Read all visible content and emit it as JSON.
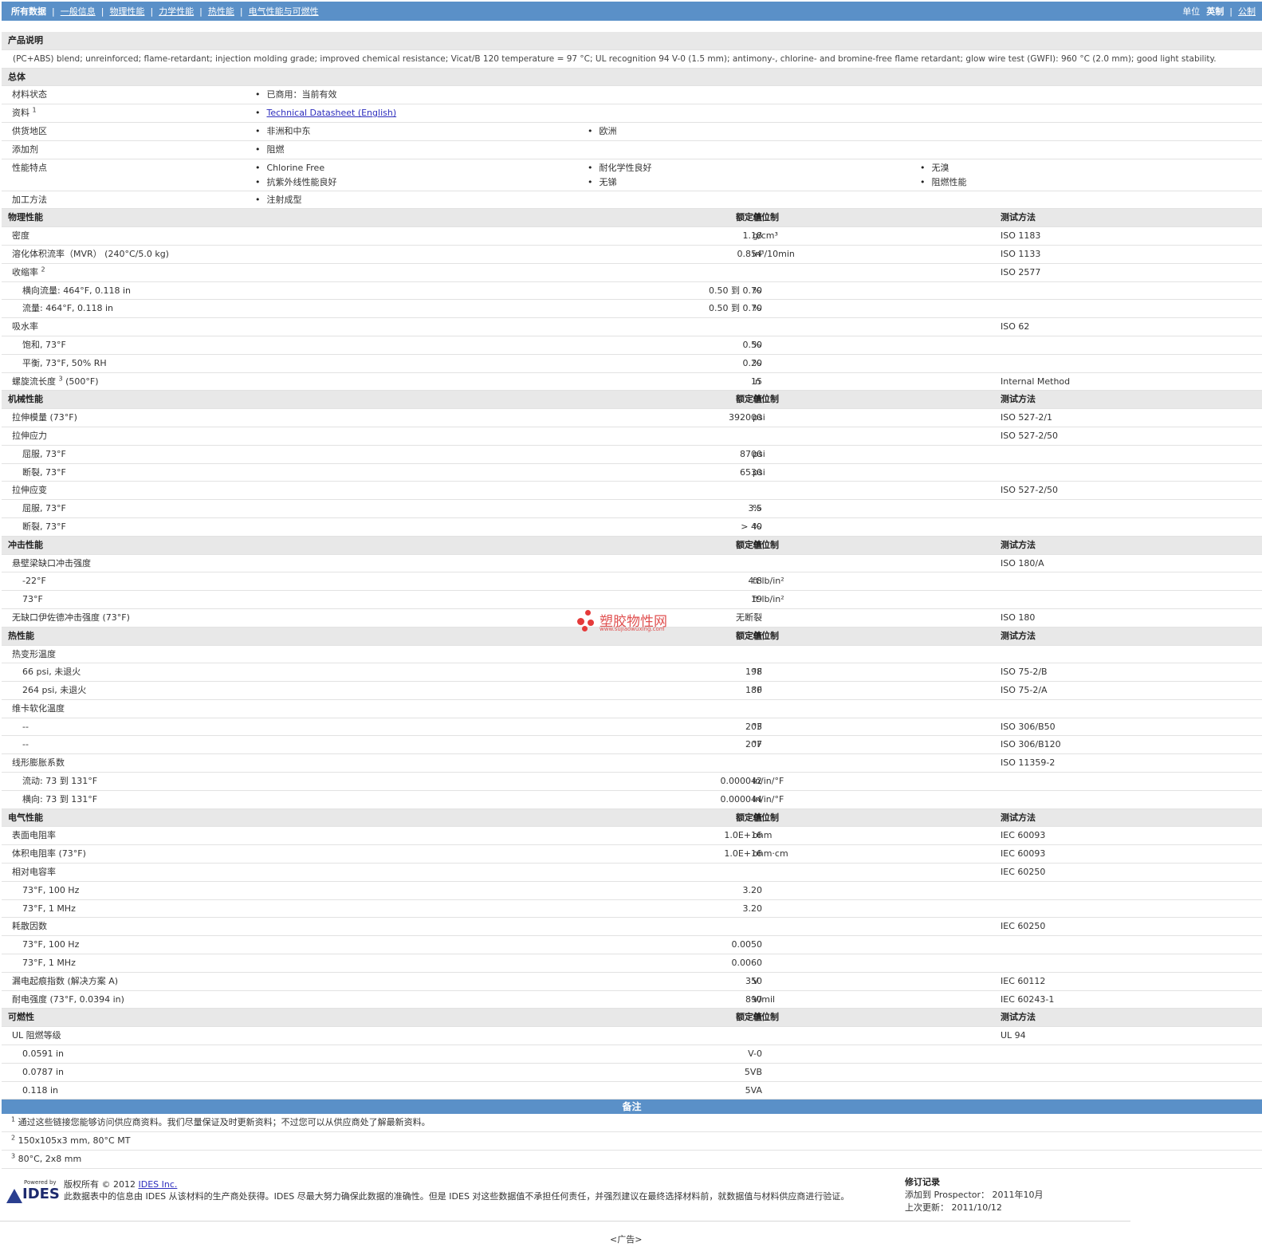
{
  "nav": {
    "tabs": [
      "所有数据",
      "一般信息",
      "物理性能",
      "力学性能",
      "热性能",
      "电气性能与可燃性"
    ],
    "units_label": "单位",
    "units": [
      "英制",
      "公制"
    ]
  },
  "sections": {
    "description": {
      "title": "产品说明",
      "text": "(PC+ABS) blend; unreinforced; flame-retardant; injection molding grade; improved chemical resistance; Vicat/B 120 temperature = 97 °C; UL recognition 94 V-0 (1.5 mm); antimony-, chlorine- and bromine-free flame retardant; glow wire test (GWFI): 960 °C (2.0 mm); good light stability."
    },
    "general": {
      "title": "总体",
      "status_label": "材料状态",
      "status_value": "已商用：当前有效",
      "docs_label": "资料",
      "docs_sup": "1",
      "docs_value": "Technical Datasheet (English)",
      "region_label": "供货地区",
      "region_values": [
        "非洲和中东",
        "欧洲"
      ],
      "additive_label": "添加剂",
      "additive_value": "阻燃",
      "features_label": "性能特点",
      "features": [
        "Chlorine Free",
        "耐化学性良好",
        "无溴",
        "抗紫外线性能良好",
        "无锑",
        "阻燃性能"
      ],
      "process_label": "加工方法",
      "process_value": "注射成型"
    },
    "col_headers": {
      "value": "额定值",
      "unit": "单位制",
      "method": "测试方法"
    },
    "physical": {
      "title": "物理性能",
      "rows": [
        {
          "label": "密度",
          "value": "1.18",
          "unit": "g/cm³",
          "method": "ISO 1183"
        },
        {
          "label": "溶化体积流率（MVR） (240°C/5.0 kg)",
          "value": "0.854",
          "unit": "in³/10min",
          "method": "ISO 1133"
        },
        {
          "label": "收缩率",
          "sup": "2",
          "method": "ISO 2577"
        },
        {
          "label": "横向流量: 464°F, 0.118 in",
          "sub": true,
          "value": "0.50 到  0.70",
          "unit": "%"
        },
        {
          "label": "流量: 464°F, 0.118 in",
          "sub": true,
          "value": "0.50 到  0.70",
          "unit": "%"
        },
        {
          "label": "吸水率",
          "method": "ISO 62"
        },
        {
          "label": "饱和, 73°F",
          "sub": true,
          "value": "0.50",
          "unit": "%"
        },
        {
          "label": "平衡, 73°F, 50% RH",
          "sub": true,
          "value": "0.20",
          "unit": "%"
        },
        {
          "label": "螺旋流长度",
          "sup": "3",
          "suffix": "(500°F)",
          "value": "15",
          "unit": "in",
          "method": "Internal Method"
        }
      ]
    },
    "mechanical": {
      "title": "机械性能",
      "rows": [
        {
          "label": "拉伸模量 (73°F)",
          "value": "392000",
          "unit": "psi",
          "method": "ISO 527-2/1"
        },
        {
          "label": "拉伸应力",
          "method": "ISO 527-2/50"
        },
        {
          "label": "屈服, 73°F",
          "sub": true,
          "value": "8700",
          "unit": "psi"
        },
        {
          "label": "断裂, 73°F",
          "sub": true,
          "value": "6530",
          "unit": "psi"
        },
        {
          "label": "拉伸应变",
          "method": "ISO 527-2/50"
        },
        {
          "label": "屈服, 73°F",
          "sub": true,
          "value": "3.5",
          "unit": "%"
        },
        {
          "label": "断裂, 73°F",
          "sub": true,
          "value": "> 40",
          "unit": "%"
        }
      ]
    },
    "impact": {
      "title": "冲击性能",
      "rows": [
        {
          "label": "悬壁梁缺口冲击强度",
          "method": "ISO 180/A"
        },
        {
          "label": "-22°F",
          "sub": true,
          "value": "4.8",
          "unit": "ft·lb/in²"
        },
        {
          "label": "73°F",
          "sub": true,
          "value": "19",
          "unit": "ft·lb/in²"
        },
        {
          "label": "无缺口伊佐德冲击强度 (73°F)",
          "value": "无断裂",
          "method": "ISO 180"
        }
      ]
    },
    "thermal": {
      "title": "热性能",
      "rows": [
        {
          "label": "热变形温度"
        },
        {
          "label": "66 psi, 未退火",
          "sub": true,
          "value": "198",
          "unit": "°F",
          "method": "ISO 75-2/B"
        },
        {
          "label": "264 psi, 未退火",
          "sub": true,
          "value": "180",
          "unit": "°F",
          "method": "ISO 75-2/A"
        },
        {
          "label": "维卡软化温度"
        },
        {
          "label": "--",
          "sub": true,
          "value": "203",
          "unit": "°F",
          "method": "ISO 306/B50"
        },
        {
          "label": "--",
          "sub": true,
          "value": "207",
          "unit": "°F",
          "method": "ISO 306/B120"
        },
        {
          "label": "线形膨胀系数",
          "method": "ISO 11359-2"
        },
        {
          "label": "流动: 73 到  131°F",
          "sub": true,
          "value": "0.000042",
          "unit": "in/in/°F"
        },
        {
          "label": "横向: 73 到  131°F",
          "sub": true,
          "value": "0.000044",
          "unit": "in/in/°F"
        }
      ]
    },
    "electrical": {
      "title": "电气性能",
      "rows": [
        {
          "label": "表面电阻率",
          "value": "1.0E+16",
          "unit": "ohm",
          "method": "IEC 60093"
        },
        {
          "label": "体积电阻率 (73°F)",
          "value": "1.0E+16",
          "unit": "ohm·cm",
          "method": "IEC 60093"
        },
        {
          "label": "相对电容率",
          "method": "IEC 60250"
        },
        {
          "label": "73°F, 100 Hz",
          "sub": true,
          "value": "3.20"
        },
        {
          "label": "73°F, 1 MHz",
          "sub": true,
          "value": "3.20"
        },
        {
          "label": "耗散因数",
          "method": "IEC 60250"
        },
        {
          "label": "73°F, 100 Hz",
          "sub": true,
          "value": "0.0050"
        },
        {
          "label": "73°F, 1 MHz",
          "sub": true,
          "value": "0.0060"
        },
        {
          "label": "漏电起痕指数 (解决方案 A)",
          "value": "350",
          "unit": "V",
          "method": "IEC 60112"
        },
        {
          "label": "耐电强度 (73°F, 0.0394 in)",
          "value": "890",
          "unit": "V/mil",
          "method": "IEC 60243-1"
        }
      ]
    },
    "flammability": {
      "title": "可燃性",
      "rows": [
        {
          "label": "UL 阻燃等级",
          "method": "UL 94"
        },
        {
          "label": "0.0591 in",
          "sub": true,
          "value": "V-0"
        },
        {
          "label": "0.0787 in",
          "sub": true,
          "value": "5VB"
        },
        {
          "label": "0.118 in",
          "sub": true,
          "value": "5VA"
        }
      ]
    }
  },
  "notes": {
    "title": "备注",
    "items": [
      {
        "num": "1",
        "text": "通过这些链接您能够访问供应商资料。我们尽量保证及时更新资料；不过您可以从供应商处了解最新资料。"
      },
      {
        "num": "2",
        "text": "150x105x3 mm, 80°C MT"
      },
      {
        "num": "3",
        "text": "80°C, 2x8 mm"
      }
    ]
  },
  "footer": {
    "powered_by": "Powered by",
    "logo_text": "IDES",
    "copyright_prefix": "版权所有 © 2012 ",
    "copyright_link": "IDES Inc.",
    "disclaimer": "此数据表中的信息由 IDES 从该材料的生产商处获得。IDES 尽最大努力确保此数据的准确性。但是 IDES 对这些数据值不承担任何责任，并强烈建议在最终选择材料前，就数据值与材料供应商进行验证。",
    "rev_title": "修订记录",
    "rev_added": "添加到 Prospector： 2011年10月",
    "rev_updated": "上次更新： 2011/10/12",
    "ad": "<广告>"
  },
  "watermark": {
    "text": "塑胶物性网",
    "url": "www.sujiaowuxing.com"
  }
}
